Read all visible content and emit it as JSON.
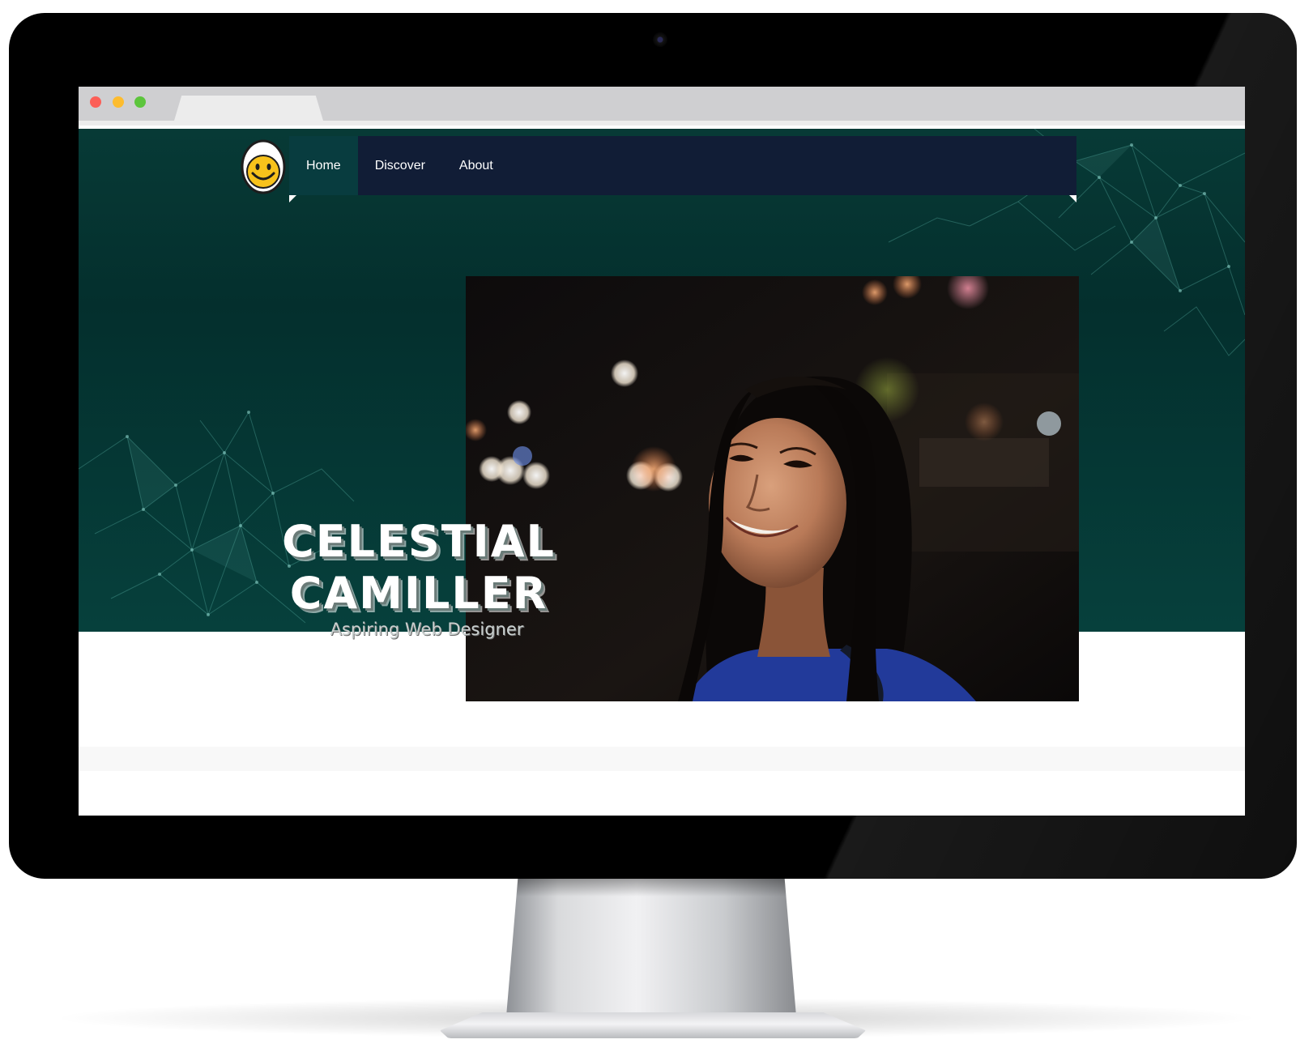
{
  "page": {
    "nav": {
      "items": [
        {
          "label": "Home",
          "active": true
        },
        {
          "label": "Discover",
          "active": false
        },
        {
          "label": "About",
          "active": false
        }
      ]
    },
    "hero": {
      "name_line1": "CELESTIAL",
      "name_line2": "CAMILLER",
      "subtitle": "Aspiring Web Designer"
    }
  },
  "icons": {
    "logo": "smiley-egg-icon",
    "browser_controls": [
      "close-dot-icon",
      "minimize-dot-icon",
      "maximize-dot-icon"
    ]
  },
  "colors": {
    "hero_bg": "#06403c",
    "navbar_bg": "#111d36",
    "nav_active_bg": "#083c3f",
    "logo_yellow": "#f7c21b"
  }
}
